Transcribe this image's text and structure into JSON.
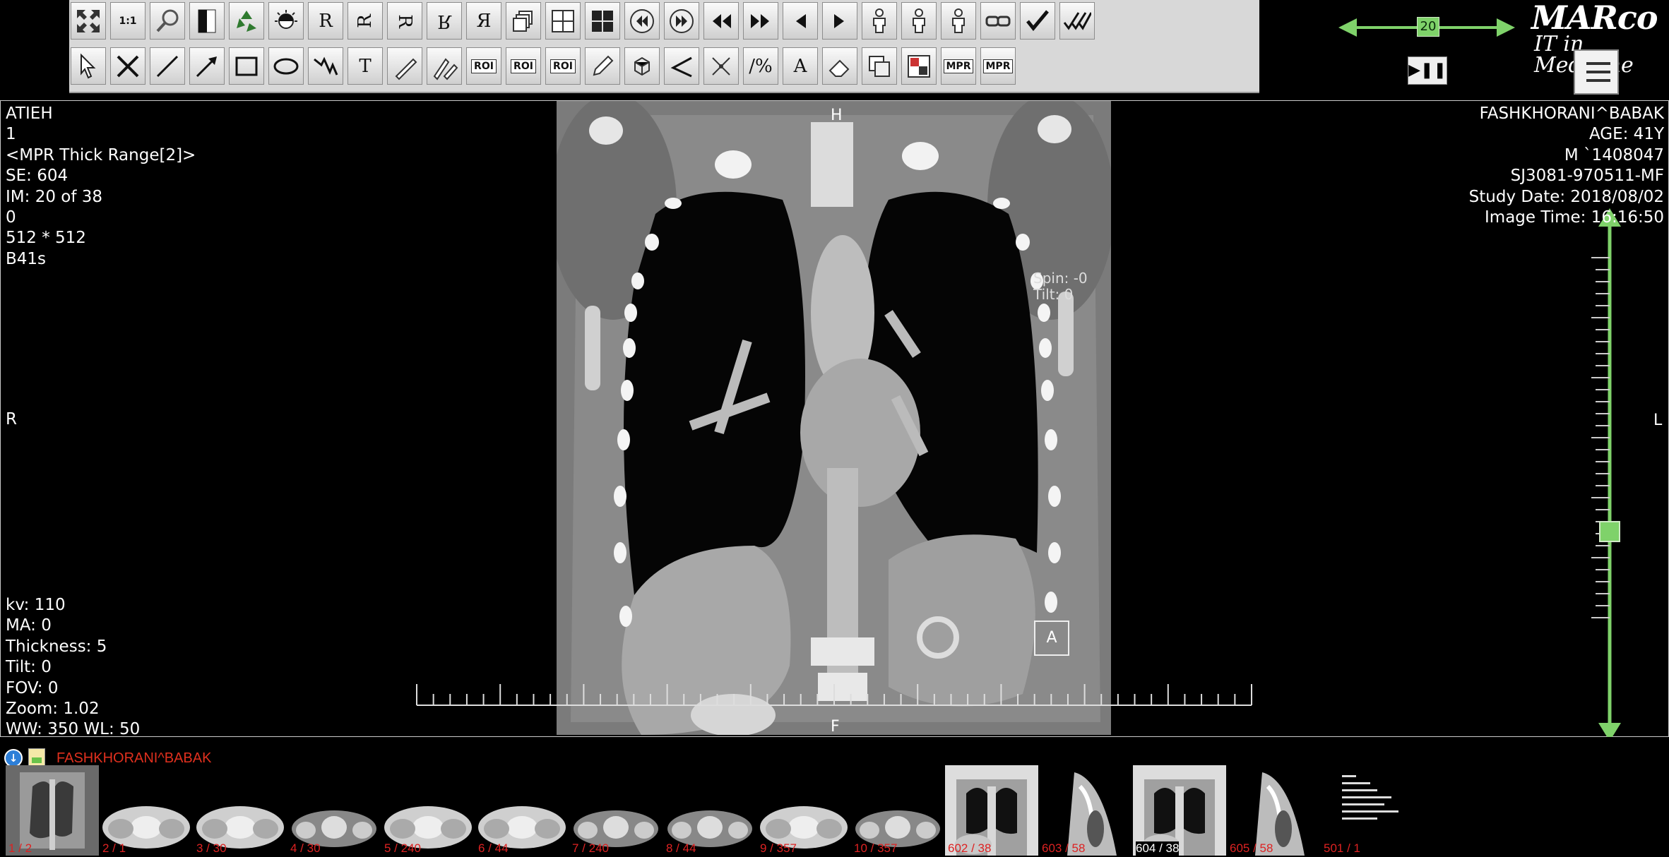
{
  "toolbar": {
    "row1": [
      {
        "name": "fullscreen-button",
        "icon": "expand-icon",
        "label": ""
      },
      {
        "name": "actual-size-button",
        "icon": "one-to-one-icon",
        "label": "1:1"
      },
      {
        "name": "zoom-button",
        "icon": "magnifier-icon",
        "label": ""
      },
      {
        "name": "invert-button",
        "icon": "invert-icon",
        "label": ""
      },
      {
        "name": "reset-button",
        "icon": "recycle-icon",
        "label": ""
      },
      {
        "name": "window-level-button",
        "icon": "contrast-icon",
        "label": ""
      },
      {
        "name": "flip-normal-button",
        "icon": "r-normal-icon",
        "label": "R"
      },
      {
        "name": "rotate-r-button",
        "icon": "r-rotated-icon",
        "label": "R"
      },
      {
        "name": "rotate-r-ccw-button",
        "icon": "r-rotated-ccw-icon",
        "label": "R"
      },
      {
        "name": "flip-vertical-button",
        "icon": "r-flip-vertical-icon",
        "label": "R"
      },
      {
        "name": "flip-horizontal-button",
        "icon": "r-flip-horizontal-icon",
        "label": "Я"
      },
      {
        "name": "stack-button",
        "icon": "stack-icon",
        "label": ""
      },
      {
        "name": "layout-2x2-button",
        "icon": "grid-icon",
        "label": ""
      },
      {
        "name": "layout-quad-button",
        "icon": "quad-icon",
        "label": ""
      },
      {
        "name": "cine-rewind-button",
        "icon": "rewind-circle-icon",
        "label": ""
      },
      {
        "name": "cine-forward-button",
        "icon": "forward-circle-icon",
        "label": ""
      },
      {
        "name": "first-image-button",
        "icon": "double-left-icon",
        "label": ""
      },
      {
        "name": "last-image-button",
        "icon": "double-right-icon",
        "label": ""
      },
      {
        "name": "prev-image-button",
        "icon": "left-triangle-icon",
        "label": ""
      },
      {
        "name": "next-image-button",
        "icon": "right-triangle-icon",
        "label": ""
      },
      {
        "name": "patient-orientation-button",
        "icon": "body-icon",
        "label": ""
      },
      {
        "name": "patient-front-button",
        "icon": "body-icon",
        "label": ""
      },
      {
        "name": "patient-side-button",
        "icon": "body-icon",
        "label": ""
      },
      {
        "name": "link-series-button",
        "icon": "chain-icon",
        "label": ""
      },
      {
        "name": "accept-button",
        "icon": "check-icon",
        "label": ""
      },
      {
        "name": "accept-all-button",
        "icon": "multi-check-icon",
        "label": ""
      }
    ],
    "row2": [
      {
        "name": "pointer-button",
        "icon": "cursor-icon",
        "label": ""
      },
      {
        "name": "delete-button",
        "icon": "x-icon",
        "label": ""
      },
      {
        "name": "line-button",
        "icon": "line-icon",
        "label": ""
      },
      {
        "name": "arrow-button",
        "icon": "arrow-icon",
        "label": ""
      },
      {
        "name": "rectangle-button",
        "icon": "rectangle-icon",
        "label": ""
      },
      {
        "name": "ellipse-button",
        "icon": "ellipse-icon",
        "label": ""
      },
      {
        "name": "freehand-button",
        "icon": "zigzag-icon",
        "label": ""
      },
      {
        "name": "text-button",
        "icon": "text-icon",
        "label": "T"
      },
      {
        "name": "ruler-button",
        "icon": "ruler-icon",
        "label": ""
      },
      {
        "name": "angle-ruler-button",
        "icon": "ruler-angle-icon",
        "label": ""
      },
      {
        "name": "roi-rect-button",
        "icon": "roi-rect-icon",
        "label": "ROI"
      },
      {
        "name": "roi-ellipse-button",
        "icon": "roi-ellipse-icon",
        "label": "ROI"
      },
      {
        "name": "roi-free-button",
        "icon": "roi-free-icon",
        "label": "ROI"
      },
      {
        "name": "pen-button",
        "icon": "pen-icon",
        "label": ""
      },
      {
        "name": "cube-button",
        "icon": "cube-icon",
        "label": ""
      },
      {
        "name": "angle-button",
        "icon": "angle-icon",
        "label": ""
      },
      {
        "name": "cross-button",
        "icon": "cross-icon",
        "label": ""
      },
      {
        "name": "percent-button",
        "icon": "percent-icon",
        "label": "/%"
      },
      {
        "name": "annotation-button",
        "icon": "letter-a-icon",
        "label": "A"
      },
      {
        "name": "eraser-button",
        "icon": "eraser-icon",
        "label": ""
      },
      {
        "name": "series-copy-button",
        "icon": "copy-icon",
        "label": ""
      },
      {
        "name": "compare-button",
        "icon": "compare-icon",
        "label": ""
      },
      {
        "name": "mpr-cross-button",
        "icon": "mpr-cross-icon",
        "label": "MPR"
      },
      {
        "name": "mpr-oblique-button",
        "icon": "mpr-oblique-icon",
        "label": "MPR"
      }
    ]
  },
  "slice_nav": {
    "value": "20"
  },
  "brand": {
    "line1": "MARco",
    "line2": "IT in Medicine"
  },
  "overlay": {
    "top_left": [
      "ATIEH",
      "1",
      "<MPR Thick Range[2]>",
      "SE: 604",
      "IM: 20 of 38",
      "0",
      "512 * 512",
      "B41s"
    ],
    "top_right": [
      "FASHKHORANI^BABAK",
      "AGE: 41Y",
      "M `1408047",
      "SJ3081-970511-MF",
      "Study Date: 2018/08/02",
      "Image Time: 16:16:50"
    ],
    "bottom_left": [
      "kv: 110",
      "MA: 0",
      "Thickness: 5",
      "Tilt: 0",
      "FOV: 0",
      "Zoom: 1.02",
      "WW: 350 WL: 50"
    ],
    "left_orient": "R",
    "right_orient": "L",
    "top_orient": "H",
    "bottom_orient": "F",
    "spin_tilt": [
      "Spin: -0",
      "Tilt: 0"
    ],
    "anterior_marker": "A"
  },
  "strip": {
    "patient": "FASHKHORANI^BABAK",
    "thumbs": [
      {
        "label": "1 / 2",
        "kind": "scout"
      },
      {
        "label": "2 / 1",
        "kind": "axial"
      },
      {
        "label": "3 / 30",
        "kind": "axial"
      },
      {
        "label": "4 / 30",
        "kind": "axial2"
      },
      {
        "label": "5 / 240",
        "kind": "axial"
      },
      {
        "label": "6 / 44",
        "kind": "axial"
      },
      {
        "label": "7 / 240",
        "kind": "axial2"
      },
      {
        "label": "8 / 44",
        "kind": "axial2"
      },
      {
        "label": "9 / 357",
        "kind": "axial"
      },
      {
        "label": "10 / 357",
        "kind": "axial2"
      },
      {
        "label": "602 / 38",
        "kind": "coronal"
      },
      {
        "label": "603 / 58",
        "kind": "sagittal"
      },
      {
        "label": "604 / 38",
        "kind": "coronal",
        "selected": true
      },
      {
        "label": "605 / 58",
        "kind": "sagittal"
      },
      {
        "label": "501 / 1",
        "kind": "report"
      }
    ]
  }
}
